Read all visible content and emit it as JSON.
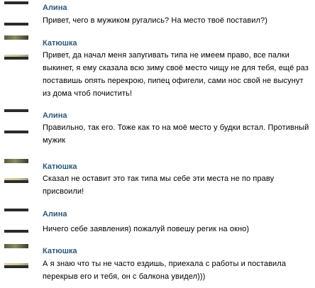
{
  "messages": [
    {
      "author": "Алина",
      "avatar": "dark-bars-avatar",
      "text": "Привет, чего в мужиком ругались? На место твоё поставил?)"
    },
    {
      "author": "Катюшка",
      "avatar": "photo-avatar",
      "text": "Привет, да начал меня запугивать типа не имеем право, все палки выкинет, я ему сказала всю зиму своё место чищу не для тебя, ещё раз поставишь опять перекрою, пипец офигели, сами нос свой не высунут из дома чтоб почистить!"
    },
    {
      "author": "Алина",
      "avatar": "dark-bars-avatar",
      "text": "Правильно, так его. Тоже как то на моё место у будки встал. Противный мужик"
    },
    {
      "author": "Катюшка",
      "avatar": "photo-avatar",
      "text": "Сказал не оставит это так типа мы себе эти места не по праву присвоили!"
    },
    {
      "author": "Алина",
      "avatar": "dark-bars-avatar",
      "text": "Ничего себе заявления) пожалуй повешу регик на окно)"
    },
    {
      "author": "Катюшка",
      "avatar": "photo-avatar",
      "text": "А я знаю что ты не часто ездишь, приехала с работы и поставила перекрыв его и тебя, он с балкона увидел)))"
    }
  ],
  "colors": {
    "author_name": "#2b587a",
    "message_text": "#000000",
    "background": "#ffffff"
  }
}
